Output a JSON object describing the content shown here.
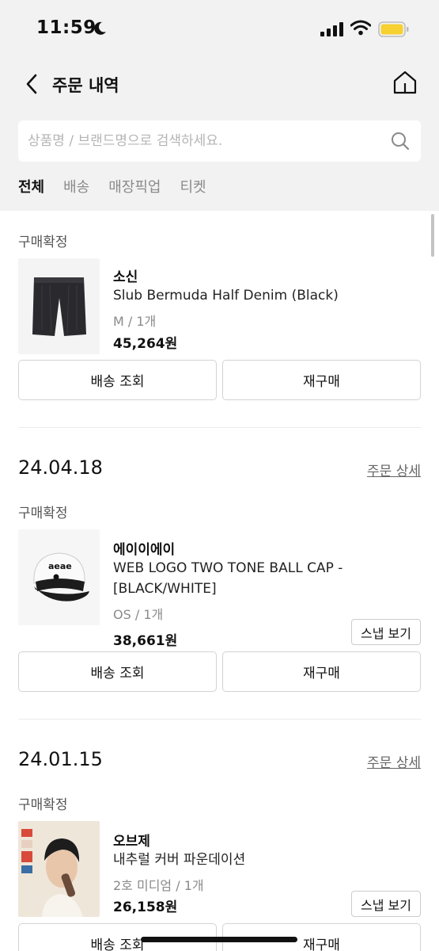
{
  "status_bar": {
    "time": "11:59",
    "icons": [
      "moon-icon",
      "signal-icon",
      "wifi-icon",
      "battery-icon"
    ],
    "battery_color": "#f7d031"
  },
  "header": {
    "title": "주문 내역",
    "back_icon": "chevron-left-icon",
    "home_icon": "home-icon"
  },
  "search": {
    "placeholder": "상품명 / 브랜드명으로 검색하세요.",
    "value": ""
  },
  "tabs": [
    {
      "label": "전체",
      "active": true
    },
    {
      "label": "배송",
      "active": false
    },
    {
      "label": "매장픽업",
      "active": false
    },
    {
      "label": "티켓",
      "active": false
    }
  ],
  "orders": [
    {
      "date": "",
      "detail_link": "",
      "status": "구매확정",
      "brand": "소신",
      "name": "Slub Bermuda Half Denim (Black)",
      "option": "M / 1개",
      "price": "45,264원",
      "snap_label": "",
      "actions": {
        "track": "배송 조회",
        "reorder": "재구매"
      }
    },
    {
      "date": "24.04.18",
      "detail_link": "주문 상세",
      "status": "구매확정",
      "brand": "에이이에이",
      "name": "WEB LOGO TWO TONE BALL CAP - [BLACK/WHITE]",
      "option": "OS / 1개",
      "price": "38,661원",
      "snap_label": "스냅 보기",
      "thumb_text": "aeae",
      "actions": {
        "track": "배송 조회",
        "reorder": "재구매"
      }
    },
    {
      "date": "24.01.15",
      "detail_link": "주문 상세",
      "status": "구매확정",
      "brand": "오브제",
      "name": "내추럴 커버 파운데이션",
      "option": "2호 미디엄 / 1개",
      "price": "26,158원",
      "snap_label": "스냅 보기",
      "actions": {
        "track": "배송 조회",
        "reorder": "재구매"
      }
    }
  ]
}
